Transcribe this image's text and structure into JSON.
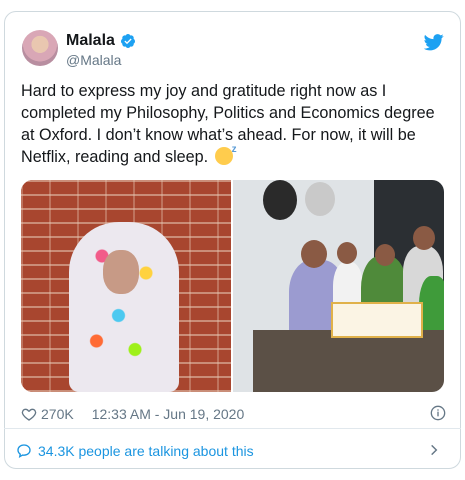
{
  "author": {
    "name": "Malala",
    "handle": "@Malala",
    "verified": true
  },
  "tweet": {
    "text": "Hard to express my joy and gratitude right now as I completed my Philosophy, Politics and Economics degree at Oxford. I don’t know what’s ahead. For now, it will be Netflix, reading and sleep.",
    "emoji": "sleeping-face"
  },
  "stats": {
    "likes": "270K",
    "timestamp": "12:33 AM - Jun 19, 2020"
  },
  "footer": {
    "talking": "34.3K people are talking about this"
  },
  "colors": {
    "accent": "#1b95e0",
    "twitter_blue": "#1da1f2",
    "muted": "#657786",
    "border": "#cfd9de"
  },
  "icons": [
    "verified-badge-icon",
    "twitter-bird-icon",
    "heart-icon",
    "info-icon",
    "comment-bubble-icon",
    "chevron-right-icon"
  ]
}
